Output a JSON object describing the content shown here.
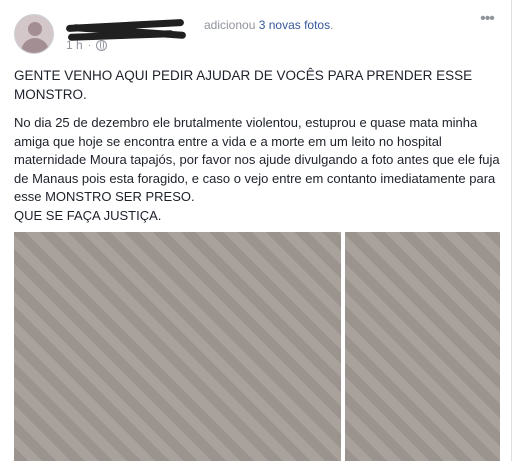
{
  "post": {
    "action_prefix": "adicionou ",
    "action_link": "3 novas fotos",
    "action_suffix": ".",
    "timestamp": "1 h",
    "privacy_icon": "globe-icon",
    "more_icon": "more-icon",
    "title": "GENTE VENHO AQUI PEDIR AJUDAR DE VOCÊS PARA PRENDER ESSE MONSTRO.",
    "body": "No dia 25 de dezembro ele brutalmente violentou, estuprou e quase mata minha amiga que hoje se encontra entre a vida e a morte em um leito no hospital maternidade Moura tapajós, por favor nos ajude divulgando a foto antes que ele fuja de Manaus pois esta foragido, e caso o vejo entre em contanto imediatamente para esse MONSTRO SER PRESO.",
    "closing": "QUE SE FAÇA JUSTIÇA."
  }
}
